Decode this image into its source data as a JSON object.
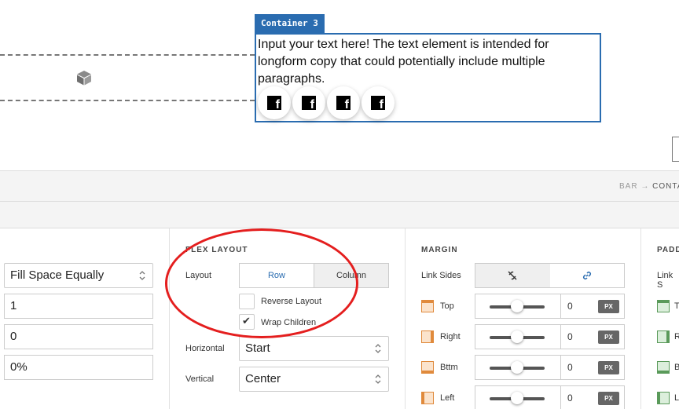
{
  "canvas": {
    "container_tag": "Container 3",
    "container_text": "Input your text here! The text element is intended for longform copy that could potentially include multiple paragraphs.",
    "social_icons": [
      "facebook-icon",
      "facebook-icon",
      "facebook-icon",
      "facebook-icon"
    ]
  },
  "breadcrumb": {
    "parent": "BAR",
    "arrow": "→",
    "current": "CONTA"
  },
  "flex_child": {
    "sizing_value": "Fill Space Equally",
    "grow_value": "1",
    "shrink_value": "0",
    "basis_value": "0%"
  },
  "flex_layout": {
    "title": "FLEX LAYOUT",
    "layout_label": "Layout",
    "row_label": "Row",
    "column_label": "Column",
    "reverse_label": "Reverse Layout",
    "wrap_label": "Wrap Children",
    "reverse_checked": false,
    "wrap_checked": true,
    "horizontal_label": "Horizontal",
    "horizontal_value": "Start",
    "vertical_label": "Vertical",
    "vertical_value": "Center"
  },
  "margin": {
    "title": "MARGIN",
    "link_sides_label": "Link Sides",
    "top_label": "Top",
    "right_label": "Right",
    "bottom_label": "Bttm",
    "left_label": "Left",
    "top_value": "0",
    "right_value": "0",
    "bottom_value": "0",
    "left_value": "0",
    "unit": "PX"
  },
  "padding": {
    "title": "PADD",
    "link_sides_label": "Link S",
    "row1": "T",
    "row2": "R",
    "row3": "B",
    "row4": "L"
  },
  "colors": {
    "accent": "#2a6cb0",
    "annotation": "#e41e1e",
    "margin_icon": "#e08a3c",
    "padding_icon": "#5a9a5a"
  }
}
